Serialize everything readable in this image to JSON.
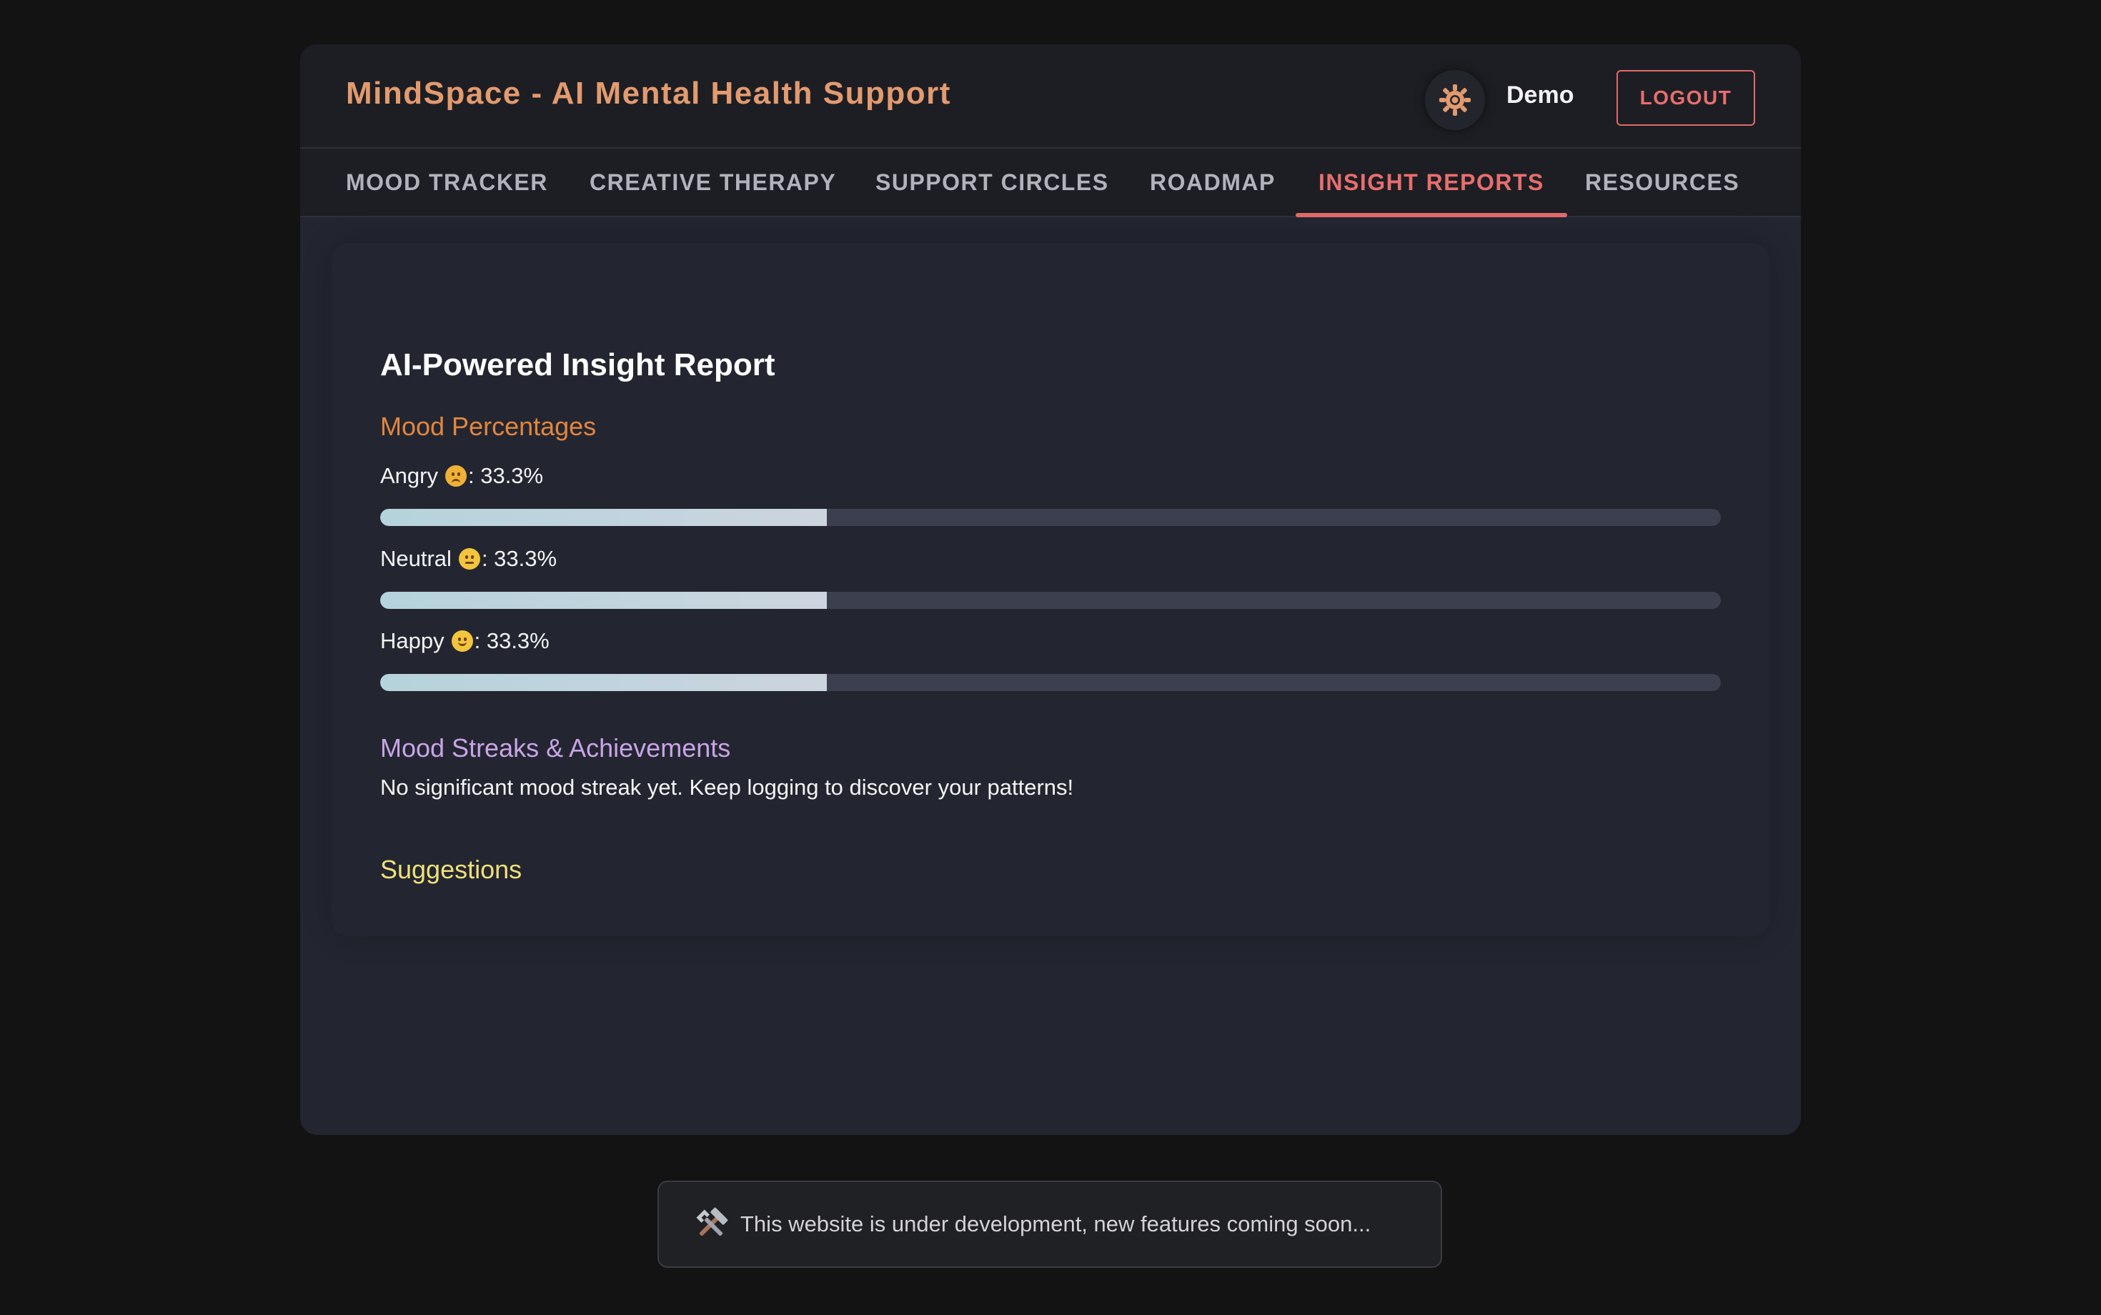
{
  "header": {
    "title": "MindSpace - AI Mental Health Support",
    "theme_toggle_icon": "sun-icon",
    "username": "Demo",
    "logout_label": "LOGOUT"
  },
  "nav": {
    "tabs": [
      {
        "label": "MOOD TRACKER",
        "active": false
      },
      {
        "label": "CREATIVE THERAPY",
        "active": false
      },
      {
        "label": "SUPPORT CIRCLES",
        "active": false
      },
      {
        "label": "ROADMAP",
        "active": false
      },
      {
        "label": "INSIGHT REPORTS",
        "active": true
      },
      {
        "label": "RESOURCES",
        "active": false
      }
    ]
  },
  "report": {
    "title": "AI-Powered Insight Report",
    "mood_heading": "Mood Percentages",
    "moods": [
      {
        "name": "Angry",
        "emoji": "angry-face-emoji",
        "percent_text": ": 33.3%",
        "value": 33.3
      },
      {
        "name": "Neutral",
        "emoji": "neutral-face-emoji",
        "percent_text": ": 33.3%",
        "value": 33.3
      },
      {
        "name": "Happy",
        "emoji": "smiling-face-emoji",
        "percent_text": ": 33.3%",
        "value": 33.3
      }
    ],
    "streak_heading": "Mood Streaks & Achievements",
    "streak_text": "No significant mood streak yet. Keep logging to discover your patterns!",
    "suggestions_heading": "Suggestions"
  },
  "toast": {
    "icon": "hammer-and-wrench-icon",
    "text": "This website is under development, new features coming soon..."
  },
  "colors": {
    "background": "#131314",
    "panel": "#232630",
    "header": "#1d1e23",
    "title_accent": "#e29a6f",
    "active_tab": "#e86e6e",
    "mood_heading": "#e2863f",
    "streak_heading": "#c9a4e8",
    "suggestions_heading": "#efe07a"
  }
}
